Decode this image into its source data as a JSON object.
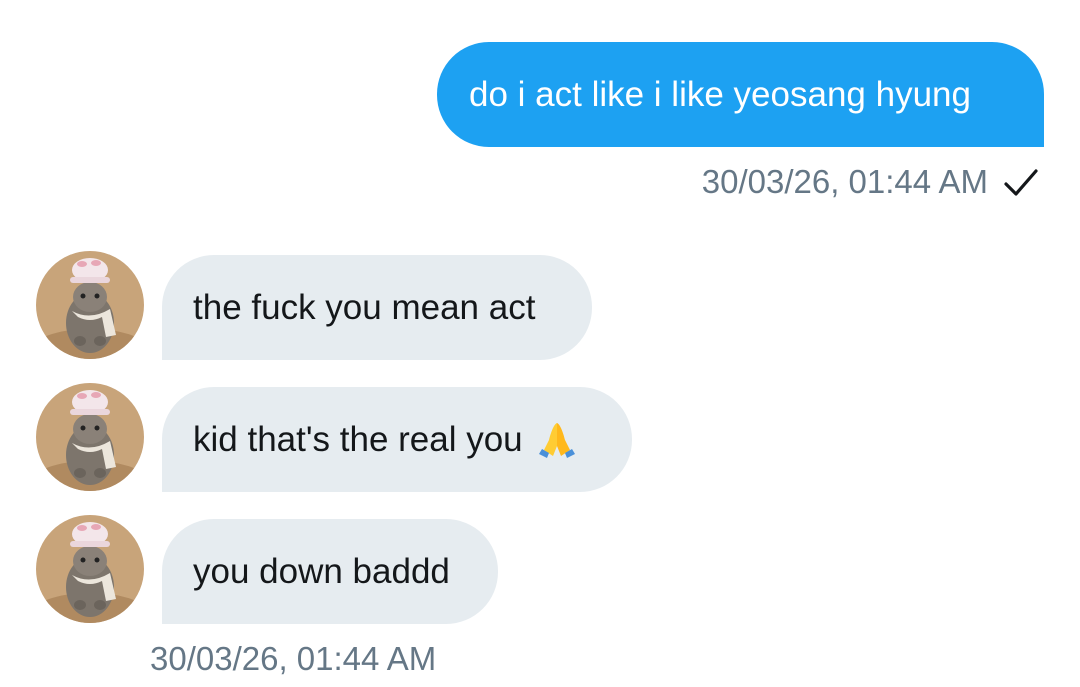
{
  "conversation": {
    "outgoing": {
      "text": "do i act like i like yeosang hyung",
      "timestamp": "30/03/26, 01:44 AM",
      "status_icon": "check-icon"
    },
    "incoming": [
      {
        "text": "the fuck you mean act"
      },
      {
        "text": "kid that's the real you",
        "emoji": "folded-hands-emoji"
      },
      {
        "text": "you down baddd"
      }
    ],
    "incoming_timestamp": "30/03/26, 01:44 AM"
  },
  "colors": {
    "outgoing_bubble": "#1da1f2",
    "incoming_bubble": "#e6ecf0",
    "timestamp_text": "#657786"
  }
}
